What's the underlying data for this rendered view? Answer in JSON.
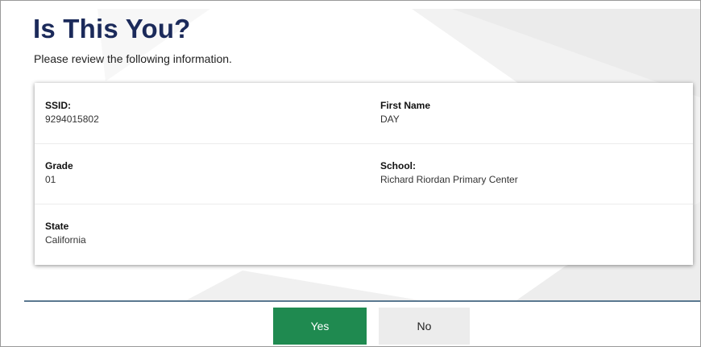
{
  "page": {
    "title": "Is This You?",
    "subtitle": "Please review the following information."
  },
  "student": {
    "ssid_label": "SSID:",
    "ssid_value": "9294015802",
    "first_name_label": "First Name",
    "first_name_value": "DAY",
    "grade_label": "Grade",
    "grade_value": "01",
    "school_label": "School:",
    "school_value": "Richard Riordan Primary Center",
    "state_label": "State",
    "state_value": "California"
  },
  "actions": {
    "yes_label": "Yes",
    "no_label": "No"
  },
  "colors": {
    "title": "#1b2a5a",
    "yes_button": "#1f8a50",
    "no_button": "#ececec",
    "divider": "#5a7890"
  }
}
